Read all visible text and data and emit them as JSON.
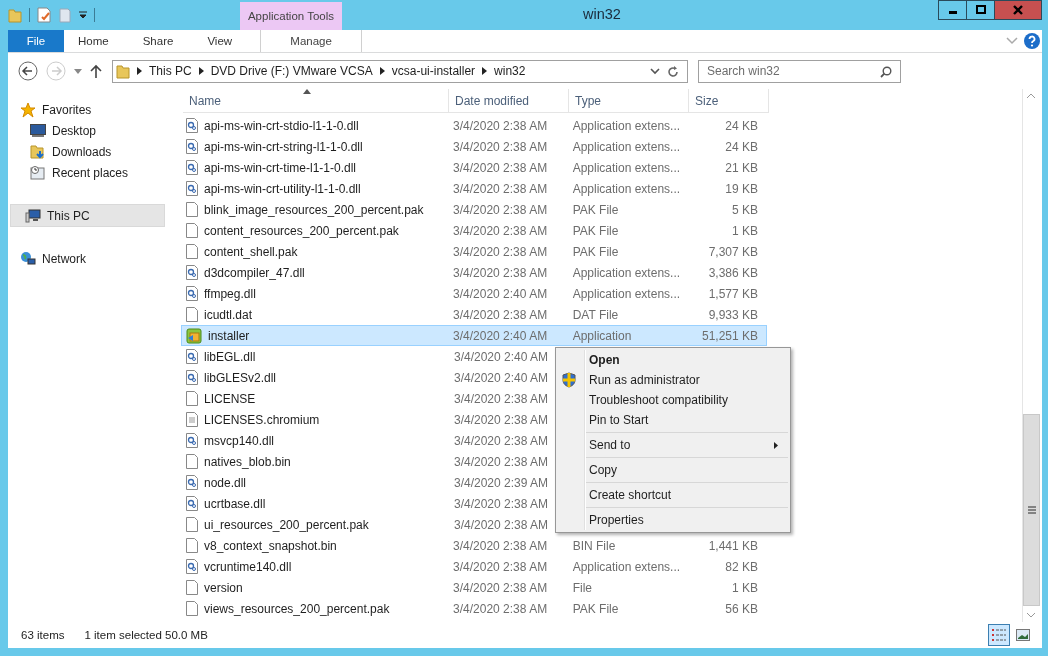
{
  "window": {
    "title": "win32"
  },
  "quick_access": {
    "contextual_group": "Application Tools"
  },
  "ribbon_tabs": [
    {
      "label": "File",
      "kind": "file",
      "selected": false
    },
    {
      "label": "Home",
      "kind": "tab",
      "selected": false
    },
    {
      "label": "Share",
      "kind": "tab",
      "selected": false
    },
    {
      "label": "View",
      "kind": "tab",
      "selected": false
    },
    {
      "label": "Manage",
      "kind": "contextual",
      "selected": false
    }
  ],
  "address": {
    "segments": [
      "This PC",
      "DVD Drive (F:) VMware VCSA",
      "vcsa-ui-installer",
      "win32"
    ]
  },
  "search": {
    "placeholder": "Search win32"
  },
  "sidebar": {
    "items": [
      {
        "label": "Favorites",
        "kind": "star",
        "selected": false,
        "children": [
          {
            "label": "Desktop",
            "kind": "desktop",
            "selected": false
          },
          {
            "label": "Downloads",
            "kind": "downloads",
            "selected": false
          },
          {
            "label": "Recent places",
            "kind": "recent",
            "selected": false
          }
        ]
      },
      {
        "label": "This PC",
        "kind": "pc",
        "selected": true
      },
      {
        "label": "Network",
        "kind": "network",
        "selected": false
      }
    ]
  },
  "table": {
    "columns": [
      "Name",
      "Date modified",
      "Type",
      "Size"
    ],
    "rows": [
      {
        "name": "api-ms-win-crt-stdio-l1-1-0.dll",
        "kind": "dll",
        "selected": false,
        "date": "3/4/2020 2:38 AM",
        "type": "Application extens...",
        "size": "24 KB"
      },
      {
        "name": "api-ms-win-crt-string-l1-1-0.dll",
        "kind": "dll",
        "selected": false,
        "date": "3/4/2020 2:38 AM",
        "type": "Application extens...",
        "size": "24 KB"
      },
      {
        "name": "api-ms-win-crt-time-l1-1-0.dll",
        "kind": "dll",
        "selected": false,
        "date": "3/4/2020 2:38 AM",
        "type": "Application extens...",
        "size": "21 KB"
      },
      {
        "name": "api-ms-win-crt-utility-l1-1-0.dll",
        "kind": "dll",
        "selected": false,
        "date": "3/4/2020 2:38 AM",
        "type": "Application extens...",
        "size": "19 KB"
      },
      {
        "name": "blink_image_resources_200_percent.pak",
        "kind": "file",
        "selected": false,
        "date": "3/4/2020 2:38 AM",
        "type": "PAK File",
        "size": "5 KB"
      },
      {
        "name": "content_resources_200_percent.pak",
        "kind": "file",
        "selected": false,
        "date": "3/4/2020 2:38 AM",
        "type": "PAK File",
        "size": "1 KB"
      },
      {
        "name": "content_shell.pak",
        "kind": "file",
        "selected": false,
        "date": "3/4/2020 2:38 AM",
        "type": "PAK File",
        "size": "7,307 KB"
      },
      {
        "name": "d3dcompiler_47.dll",
        "kind": "dll",
        "selected": false,
        "date": "3/4/2020 2:38 AM",
        "type": "Application extens...",
        "size": "3,386 KB"
      },
      {
        "name": "ffmpeg.dll",
        "kind": "dll",
        "selected": false,
        "date": "3/4/2020 2:40 AM",
        "type": "Application extens...",
        "size": "1,577 KB"
      },
      {
        "name": "icudtl.dat",
        "kind": "file",
        "selected": false,
        "date": "3/4/2020 2:38 AM",
        "type": "DAT File",
        "size": "9,933 KB"
      },
      {
        "name": "installer",
        "kind": "app",
        "selected": true,
        "date": "3/4/2020 2:40 AM",
        "type": "Application",
        "size": "51,251 KB"
      },
      {
        "name": "libEGL.dll",
        "kind": "dll",
        "selected": false,
        "date": "3/4/2020 2:40 AM"
      },
      {
        "name": "libGLESv2.dll",
        "kind": "dll",
        "selected": false,
        "date": "3/4/2020 2:40 AM"
      },
      {
        "name": "LICENSE",
        "kind": "file",
        "selected": false,
        "date": "3/4/2020 2:38 AM"
      },
      {
        "name": "LICENSES.chromium",
        "kind": "text",
        "selected": false,
        "date": "3/4/2020 2:38 AM"
      },
      {
        "name": "msvcp140.dll",
        "kind": "dll",
        "selected": false,
        "date": "3/4/2020 2:38 AM"
      },
      {
        "name": "natives_blob.bin",
        "kind": "file",
        "selected": false,
        "date": "3/4/2020 2:38 AM"
      },
      {
        "name": "node.dll",
        "kind": "dll",
        "selected": false,
        "date": "3/4/2020 2:39 AM"
      },
      {
        "name": "ucrtbase.dll",
        "kind": "dll",
        "selected": false,
        "date": "3/4/2020 2:38 AM"
      },
      {
        "name": "ui_resources_200_percent.pak",
        "kind": "file",
        "selected": false,
        "date": "3/4/2020 2:38 AM"
      },
      {
        "name": "v8_context_snapshot.bin",
        "kind": "file",
        "selected": false,
        "date": "3/4/2020 2:38 AM",
        "type": "BIN File",
        "size": "1,441 KB"
      },
      {
        "name": "vcruntime140.dll",
        "kind": "dll",
        "selected": false,
        "date": "3/4/2020 2:38 AM",
        "type": "Application extens...",
        "size": "82 KB"
      },
      {
        "name": "version",
        "kind": "file",
        "selected": false,
        "date": "3/4/2020 2:38 AM",
        "type": "File",
        "size": "1 KB"
      },
      {
        "name": "views_resources_200_percent.pak",
        "kind": "file",
        "selected": false,
        "date": "3/4/2020 2:38 AM",
        "type": "PAK File",
        "size": "56 KB"
      }
    ]
  },
  "context_menu": {
    "groups": [
      [
        {
          "label": "Open",
          "kind": "default"
        },
        {
          "label": "Run as administrator",
          "kind": "admin"
        },
        {
          "label": "Troubleshoot compatibility",
          "kind": "plain"
        },
        {
          "label": "Pin to Start",
          "kind": "plain"
        }
      ],
      [
        {
          "label": "Send to",
          "kind": "submenu"
        }
      ],
      [
        {
          "label": "Copy",
          "kind": "plain"
        }
      ],
      [
        {
          "label": "Create shortcut",
          "kind": "plain"
        }
      ],
      [
        {
          "label": "Properties",
          "kind": "plain"
        }
      ]
    ]
  },
  "status_bar": {
    "item_count": "63 items",
    "selection": "1 item selected  50.0 MB"
  },
  "view_buttons": [
    {
      "kind": "details",
      "selected": true
    },
    {
      "kind": "thumbnails",
      "selected": false
    }
  ]
}
